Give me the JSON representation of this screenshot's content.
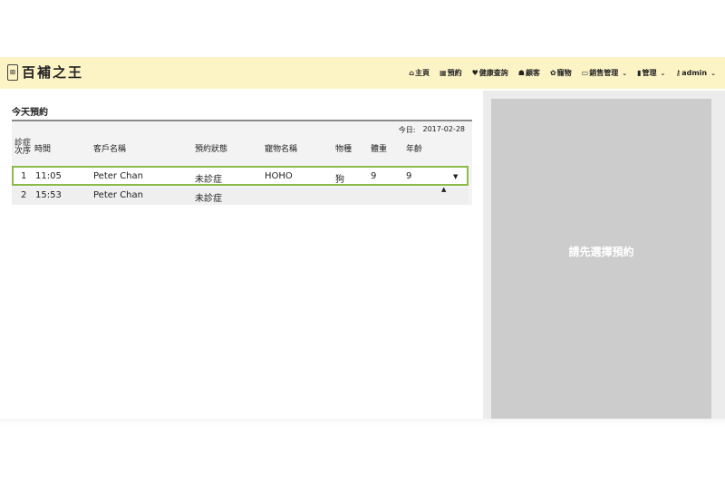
{
  "brand": {
    "seal_text": "百補",
    "name": "百補之王"
  },
  "nav": [
    {
      "icon": "home-icon",
      "glyph": "⌂",
      "label": "主頁",
      "has_caret": false
    },
    {
      "icon": "calendar-icon",
      "glyph": "▦",
      "label": "預約",
      "has_caret": false
    },
    {
      "icon": "heart-icon",
      "glyph": "♥",
      "label": "健康查詢",
      "has_caret": false
    },
    {
      "icon": "users-icon",
      "glyph": "☗",
      "label": "顧客",
      "has_caret": false
    },
    {
      "icon": "paw-icon",
      "glyph": "✿",
      "label": "寵物",
      "has_caret": false
    },
    {
      "icon": "credit-card-icon",
      "glyph": "▭",
      "label": "銷售管理",
      "has_caret": true
    },
    {
      "icon": "file-icon",
      "glyph": "▮",
      "label": "管理",
      "has_caret": true
    },
    {
      "icon": "key-icon",
      "glyph": "⚷",
      "label": "admin",
      "has_caret": true
    }
  ],
  "today": {
    "title": "今天預約",
    "date_label": "今日:",
    "date_value": "2017-02-28",
    "columns": {
      "order_line1": "診症",
      "order_line2": "次序",
      "time": "時間",
      "customer": "客戶名稱",
      "status": "預約狀態",
      "pet": "寵物名稱",
      "species": "物種",
      "weight": "體重",
      "age": "年齡"
    },
    "rows": [
      {
        "order": "1",
        "time": "11:05",
        "customer": "Peter Chan",
        "status": "未診症",
        "pet": "HOHO",
        "species": "狗",
        "weight": "9",
        "age": "9",
        "toggle": "▼"
      },
      {
        "order": "2",
        "time": "15:53",
        "customer": "Peter Chan",
        "status": "未診症",
        "pet": "",
        "species": "",
        "weight": "",
        "age": "",
        "toggle": "▲"
      }
    ]
  },
  "detail": {
    "placeholder": "請先選擇預約"
  },
  "colors": {
    "navbar_bg": "#fdf4c6",
    "selected_border": "#8bbb4a",
    "panel_bg": "#cccccc"
  }
}
